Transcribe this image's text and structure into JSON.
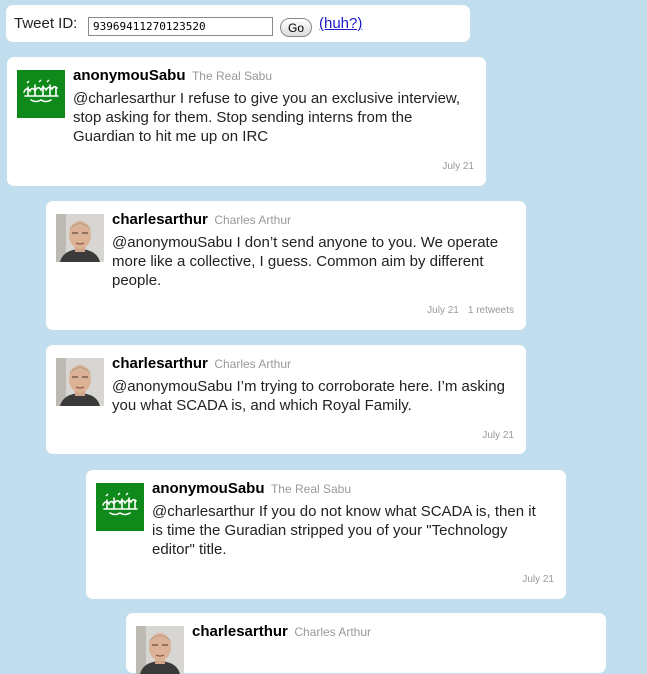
{
  "search": {
    "label": "Tweet ID:",
    "value": "93969411270123520",
    "go_label": "Go",
    "help_link": "(huh?)"
  },
  "tweets": [
    {
      "username": "anonymouSabu",
      "fullname": "The Real Sabu",
      "text": "@charlesarthur I refuse to give you an exclusive interview, stop asking for them. Stop sending interns from the Guardian to hit me up on IRC",
      "date": "July 21",
      "avatar": "green-flag-avatar"
    },
    {
      "username": "charlesarthur",
      "fullname": "Charles Arthur",
      "text": "@anonymouSabu I don’t send anyone to you. We operate more like a collective, I guess. Common aim by different people.",
      "date": "July 21",
      "retweets": "1 retweets",
      "avatar": "man-portrait-avatar"
    },
    {
      "username": "charlesarthur",
      "fullname": "Charles Arthur",
      "text": "@anonymouSabu I’m trying to corroborate here. I’m asking you what SCADA is, and which Royal Family.",
      "date": "July 21",
      "avatar": "man-portrait-avatar"
    },
    {
      "username": "anonymouSabu",
      "fullname": "The Real Sabu",
      "text": "@charlesarthur If you do not know what SCADA is, then it is time the Guradian stripped you of your \"Technology editor\" title.",
      "date": "July 21",
      "avatar": "green-flag-avatar"
    },
    {
      "username": "charlesarthur",
      "fullname": "Charles Arthur",
      "avatar": "man-portrait-avatar"
    }
  ],
  "colors": {
    "background": "#c0deed",
    "card": "#ffffff",
    "flag_green": "#0f8a1a",
    "muted_text": "#999999",
    "link": "#1a1acc"
  }
}
